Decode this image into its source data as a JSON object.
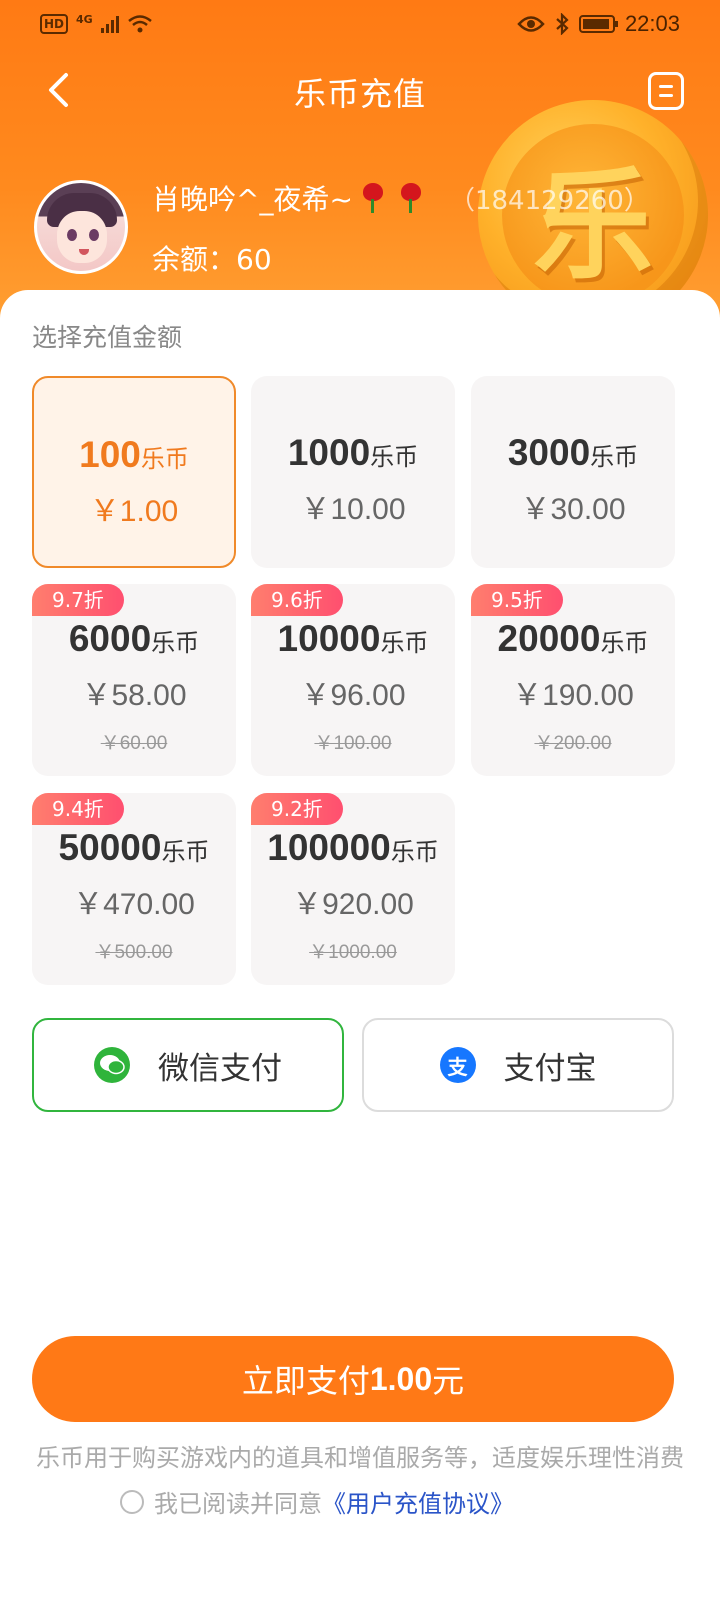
{
  "status_bar": {
    "hd": "HD",
    "network": "4G",
    "time": "22:03"
  },
  "nav": {
    "title": "乐币充值"
  },
  "user": {
    "name": "肖晚吟^_夜希~",
    "id": "（184129260）",
    "balance": "余额：60"
  },
  "coin_badge": "乐",
  "section_label": "选择充值金额",
  "coin_unit": "乐币",
  "packages": [
    {
      "coins": "100",
      "price": "￥1.00",
      "discount": "",
      "original": "",
      "selected": true
    },
    {
      "coins": "1000",
      "price": "￥10.00",
      "discount": "",
      "original": ""
    },
    {
      "coins": "3000",
      "price": "￥30.00",
      "discount": "",
      "original": ""
    },
    {
      "coins": "6000",
      "price": "￥58.00",
      "discount": "9.7折",
      "original": "￥60.00"
    },
    {
      "coins": "10000",
      "price": "￥96.00",
      "discount": "9.6折",
      "original": "￥100.00"
    },
    {
      "coins": "20000",
      "price": "￥190.00",
      "discount": "9.5折",
      "original": "￥200.00"
    },
    {
      "coins": "50000",
      "price": "￥470.00",
      "discount": "9.4折",
      "original": "￥500.00"
    },
    {
      "coins": "100000",
      "price": "￥920.00",
      "discount": "9.2折",
      "original": "￥1000.00"
    }
  ],
  "payment": {
    "wechat_label": "微信支付",
    "alipay_label": "支付宝",
    "alipay_glyph": "支",
    "selected": "wechat"
  },
  "submit": {
    "prefix": "立即支付",
    "amount": "1.00",
    "suffix": "元"
  },
  "note": "乐币用于购买游戏内的道具和增值服务等，适度娱乐理性消费",
  "agreement": {
    "text": "我已阅读并同意",
    "link": "《用户充值协议》",
    "checked": false
  },
  "colors": {
    "accent": "#ff7916",
    "selected_border": "#f08a2a",
    "wechat_green": "#31b53e",
    "alipay_blue": "#1677ff",
    "discount_tag": "#ff5a70"
  }
}
